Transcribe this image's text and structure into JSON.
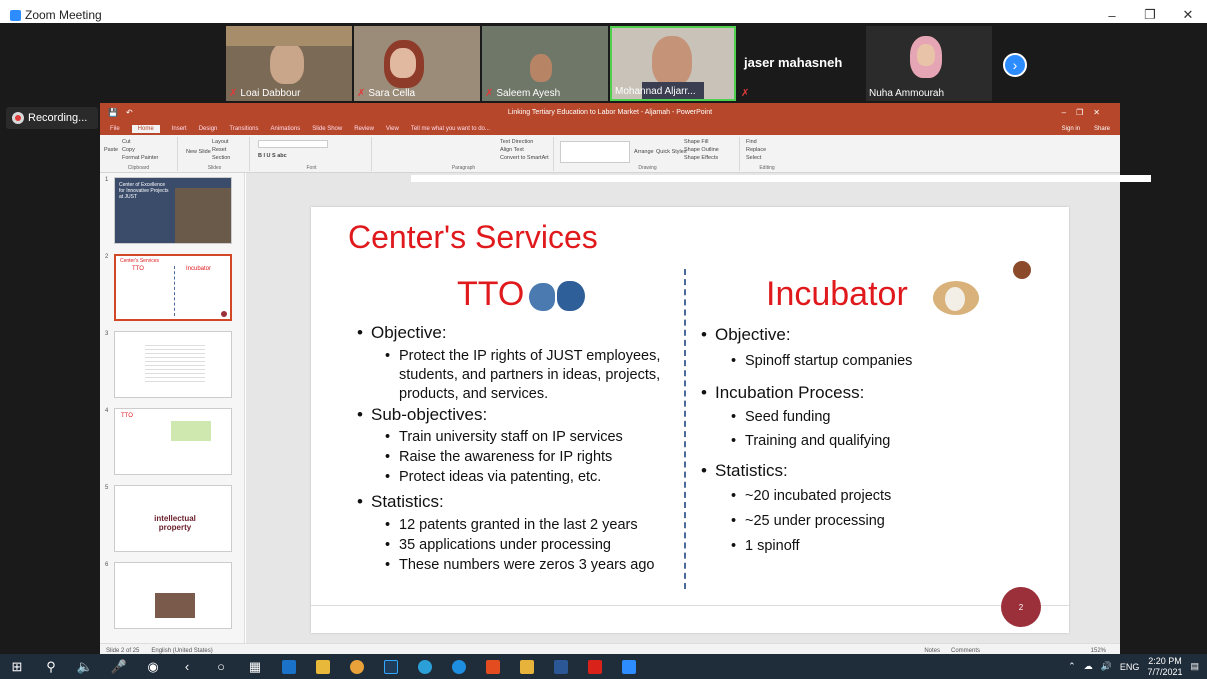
{
  "zoom": {
    "title": "Zoom Meeting",
    "recording_label": "Recording...",
    "participants": [
      {
        "name": "Loai Dabbour"
      },
      {
        "name": "Sara Cella"
      },
      {
        "name": "Saleem Ayesh"
      },
      {
        "name": "Mohannad Aljarr..."
      },
      {
        "name": "jaser mahasneh"
      },
      {
        "name": "Nuha Ammourah"
      }
    ]
  },
  "ppt": {
    "doc_title": "Linking Tertiary Education to Labor Market - Aljamah - PowerPoint",
    "signin": "Sign in",
    "share": "Share",
    "tabs": [
      "File",
      "Home",
      "Insert",
      "Design",
      "Transitions",
      "Animations",
      "Slide Show",
      "Review",
      "View"
    ],
    "tell_me": "Tell me what you want to do...",
    "ribbon": {
      "paste": "Paste",
      "cut": "Cut",
      "copy": "Copy",
      "format_painter": "Format Painter",
      "clipboard": "Clipboard",
      "new_slide": "New Slide",
      "layout": "Layout",
      "reset": "Reset",
      "section": "Section",
      "slides": "Slides",
      "font": "Font",
      "paragraph": "Paragraph",
      "text_direction": "Text Direction",
      "align_text": "Align Text",
      "convert_smartart": "Convert to SmartArt",
      "arrange": "Arrange",
      "quick_styles": "Quick Styles",
      "shape_fill": "Shape Fill",
      "shape_outline": "Shape Outline",
      "shape_effects": "Shape Effects",
      "drawing": "Drawing",
      "find": "Find",
      "replace": "Replace",
      "select": "Select",
      "editing": "Editing"
    },
    "thumb_numbers": [
      "1",
      "2",
      "3",
      "4",
      "5",
      "6"
    ],
    "thumb1_text": "Center of Excellence for Innovative Projects at JUST",
    "thumb4_text": "TTO",
    "thumb5_text": "intellectual property",
    "status_slide": "Slide 2 of 25",
    "status_lang": "English (United States)",
    "notes": "Notes",
    "comments": "Comments",
    "zoom_pct": "152%"
  },
  "slide": {
    "title": "Center's Services",
    "left_head": "TTO",
    "right_head": "Incubator",
    "left": {
      "objective": "Objective:",
      "objective_text": "Protect the IP rights of JUST employees, students, and partners in ideas, projects, products, and services.",
      "subobjectives": "Sub-objectives:",
      "sub_items": [
        "Train university staff on IP services",
        "Raise the awareness for IP rights",
        "Protect ideas via patenting, etc."
      ],
      "statistics": "Statistics:",
      "stat_items": [
        "12 patents granted in the last 2 years",
        "35 applications under processing",
        "These numbers were zeros 3 years ago"
      ]
    },
    "right": {
      "objective": "Objective:",
      "objective_items": [
        "Spinoff startup companies"
      ],
      "incubation": "Incubation Process:",
      "incubation_items": [
        "Seed funding",
        "Training and qualifying"
      ],
      "statistics": "Statistics:",
      "stat_items": [
        "~20 incubated projects",
        "~25 under processing",
        "1 spinoff"
      ]
    },
    "page_number": "2"
  },
  "taskbar": {
    "lang": "ENG",
    "time": "2:20 PM",
    "date": "7/7/2021"
  },
  "colors": {
    "ppt_accent": "#b7472a",
    "slide_title": "#e0191d",
    "zoom_blue": "#2d8cff"
  }
}
